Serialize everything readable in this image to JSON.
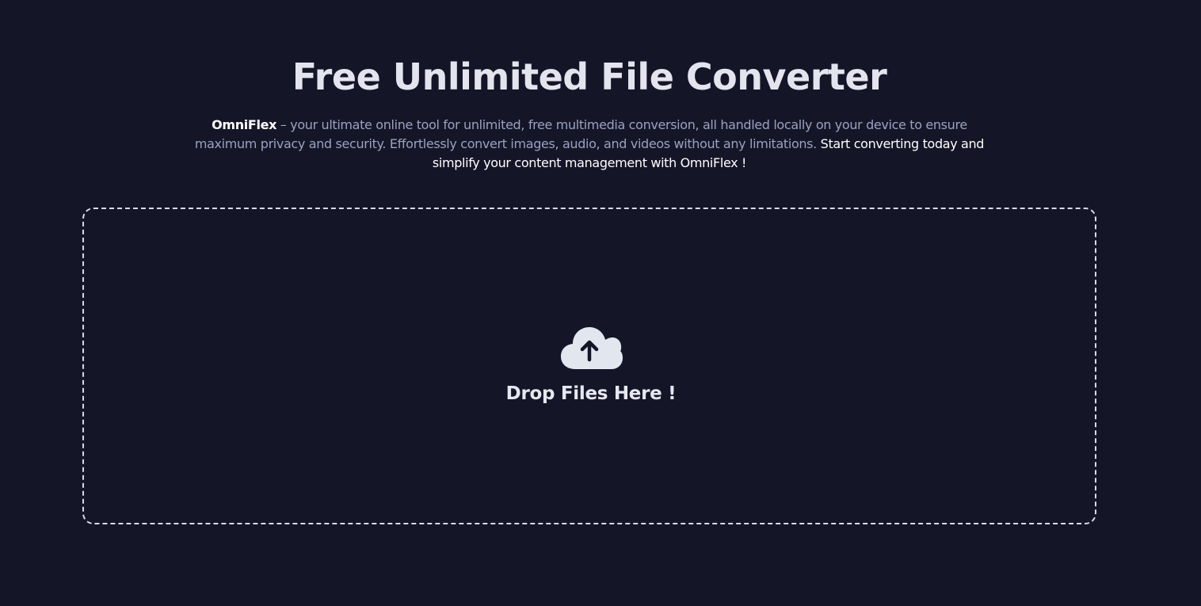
{
  "hero": {
    "title": "Free Unlimited File Converter",
    "brand": "OmniFlex",
    "description": " – your ultimate online tool for unlimited, free multimedia conversion, all handled locally on your device to ensure maximum privacy and security. Effortlessly convert images, audio, and videos without any limitations. ",
    "cta": "Start converting today and simplify your content management with OmniFlex !"
  },
  "dropzone": {
    "icon": "cloud-upload-icon",
    "label": "Drop Files Here !"
  },
  "colors": {
    "background": "#151528",
    "title": "#e4e4ee",
    "muted_text": "#9aa2bf",
    "dropzone_border": "#d8dbe6",
    "icon_fill": "#e2e6ef"
  }
}
